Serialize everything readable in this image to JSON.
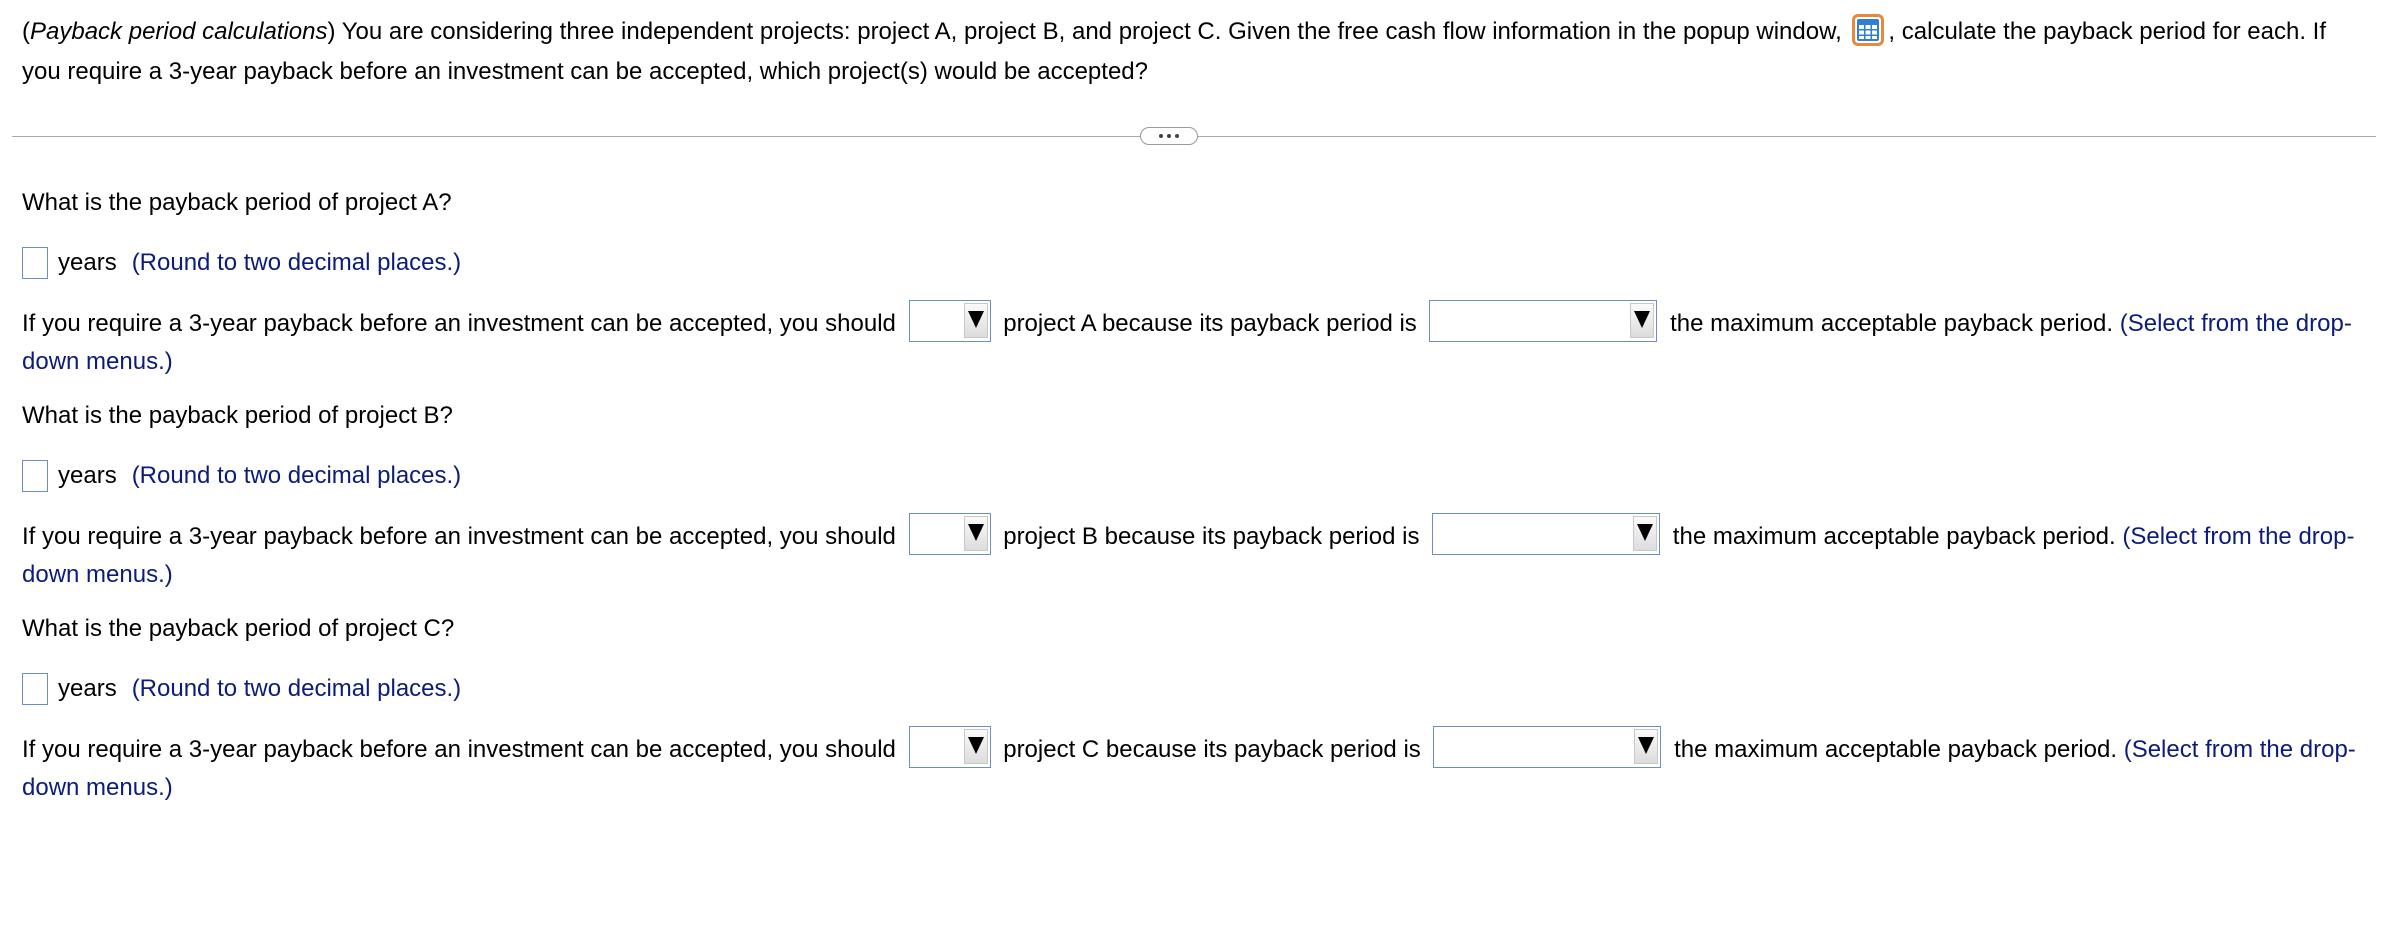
{
  "intro": {
    "open_paren": "(",
    "topic": "Payback period calculations",
    "text_before_icon": ") You are considering three independent projects: project A, project B, and project C. Given the free cash flow information in the popup window, ",
    "icon": "table-grid-icon",
    "text_after_icon": ", calculate the payback period for each. If you require a 3-year payback before an investment can be accepted, which project(s) would be accepted?"
  },
  "expand_icon": "ellipsis-icon",
  "sections": [
    {
      "question": "What is the payback period of project A?",
      "answer_value": "",
      "unit": "years",
      "round_hint": "(Round to two decimal places.)",
      "sentence_start": "If you require a 3-year payback before an investment can be accepted, you should",
      "decision_selected": "",
      "sentence_mid": "project A because its payback period is",
      "comparison_selected": "",
      "sentence_end": "the maximum acceptable payback period.",
      "select_hint": "(Select from the drop-down menus.)"
    },
    {
      "question": "What is the payback period of project B?",
      "answer_value": "",
      "unit": "years",
      "round_hint": "(Round to two decimal places.)",
      "sentence_start": "If you require a 3-year payback before an investment can be accepted, you should",
      "decision_selected": "",
      "sentence_mid": "project B because its payback period is",
      "comparison_selected": "",
      "sentence_end": "the maximum acceptable payback period.",
      "select_hint": "(Select from the drop-down menus.)"
    },
    {
      "question": "What is the payback period of project C?",
      "answer_value": "",
      "unit": "years",
      "round_hint": "(Round to two decimal places.)",
      "sentence_start": "If you require a 3-year payback before an investment can be accepted, you should",
      "decision_selected": "",
      "sentence_mid": "project C because its payback period is",
      "comparison_selected": "",
      "sentence_end": "the maximum acceptable payback period.",
      "select_hint": "(Select from the drop-down menus.)"
    }
  ],
  "colors": {
    "hint_text": "#0b1c7a",
    "field_border": "#6a8fc6",
    "icon_border": "#e8883a",
    "icon_fill": "#2f7fd6"
  }
}
